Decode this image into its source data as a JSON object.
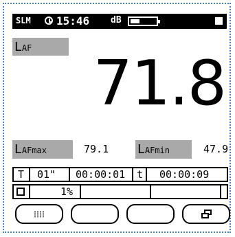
{
  "status_bar": {
    "mode": "SLM",
    "time": "15:46",
    "unit": "dB",
    "icons": [
      "clock-icon",
      "battery-icon",
      "stop-icon"
    ],
    "battery_level": 0.35
  },
  "primary": {
    "label_main": "L",
    "label_sub": "AF",
    "value": "71.8"
  },
  "stats": {
    "max": {
      "label_main": "L",
      "label_sub": "AFmax",
      "value": "79.1"
    },
    "min": {
      "label_main": "L",
      "label_sub": "AFmin",
      "value": "47.9"
    }
  },
  "timing_row": {
    "t_label": "T",
    "interval": "01\"",
    "elapsed": "00:00:01",
    "t2_label": "t",
    "total": "00:00:09"
  },
  "progress_row": {
    "icon": "page-icon",
    "percent": "1%"
  },
  "softkeys": [
    {
      "icon": "grid-icon"
    },
    {
      "icon": ""
    },
    {
      "icon": ""
    },
    {
      "icon": "windows-icon"
    }
  ],
  "colors": {
    "label_bg": "#a9a9a9",
    "frame": "#4a7fc4"
  }
}
